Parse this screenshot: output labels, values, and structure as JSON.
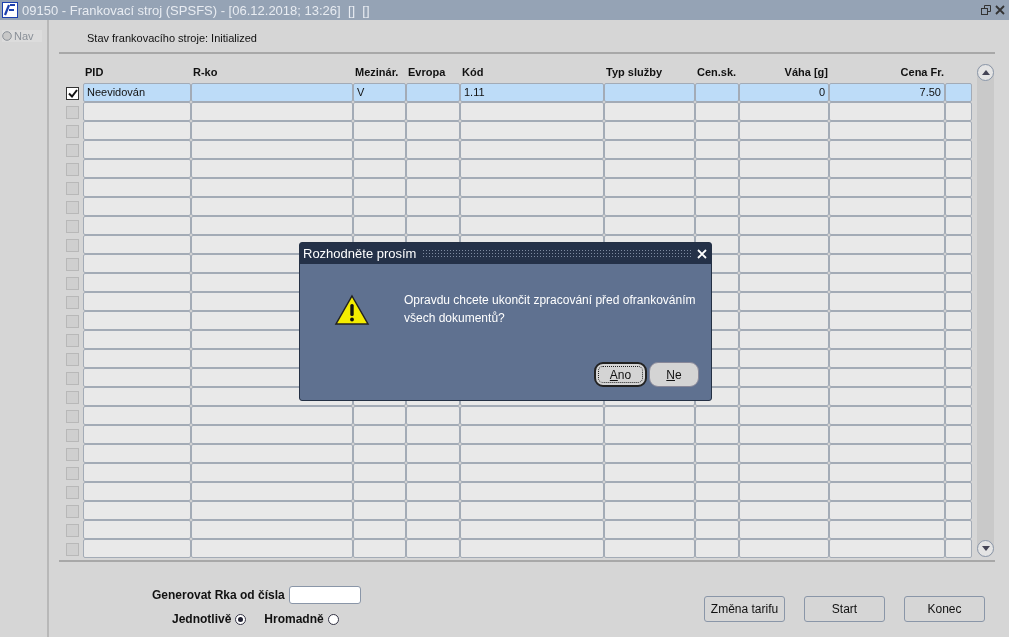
{
  "window": {
    "title": "09150 - Frankovací stroj (SPSFS) - [06.12.2018; 13:26]  []  []"
  },
  "sidebar": {
    "nav": {
      "label": "Nav",
      "selected": false
    }
  },
  "status": "Stav frankovacího stroje: Initialized",
  "table": {
    "columns": [
      {
        "label": "PID",
        "kind": "text"
      },
      {
        "label": "R-ko",
        "kind": "text"
      },
      {
        "label": "Mezinár.",
        "kind": "text"
      },
      {
        "label": "Evropa",
        "kind": "text"
      },
      {
        "label": "Kód",
        "kind": "text"
      },
      {
        "label": "Typ služby",
        "kind": "text"
      },
      {
        "label": "Cen.sk.",
        "kind": "text"
      },
      {
        "label": "Váha [g]",
        "kind": "number"
      },
      {
        "label": "Cena Fr.",
        "kind": "number"
      }
    ],
    "rows": [
      {
        "checked": true,
        "selected": true,
        "cells": {
          "0": "Neevidován",
          "2": "V",
          "4": "1.11",
          "7": "0",
          "8": "7.50"
        }
      },
      {
        "checked": false,
        "selected": false
      },
      {
        "checked": false,
        "selected": false
      },
      {
        "checked": false,
        "selected": false
      },
      {
        "checked": false,
        "selected": false
      },
      {
        "checked": false,
        "selected": false
      },
      {
        "checked": false,
        "selected": false
      },
      {
        "checked": false,
        "selected": false
      },
      {
        "checked": false,
        "selected": false
      },
      {
        "checked": false,
        "selected": false
      },
      {
        "checked": false,
        "selected": false
      },
      {
        "checked": false,
        "selected": false
      },
      {
        "checked": false,
        "selected": false
      },
      {
        "checked": false,
        "selected": false
      },
      {
        "checked": false,
        "selected": false
      },
      {
        "checked": false,
        "selected": false
      },
      {
        "checked": false,
        "selected": false
      },
      {
        "checked": false,
        "selected": false
      },
      {
        "checked": false,
        "selected": false
      },
      {
        "checked": false,
        "selected": false
      },
      {
        "checked": false,
        "selected": false
      },
      {
        "checked": false,
        "selected": false
      },
      {
        "checked": false,
        "selected": false
      },
      {
        "checked": false,
        "selected": false
      },
      {
        "checked": false,
        "selected": false
      }
    ]
  },
  "generate": {
    "label": "Generovat Rka od čísla"
  },
  "mode": [
    {
      "label": "Jednotlivě",
      "selected": true
    },
    {
      "label": "Hromadně",
      "selected": false
    }
  ],
  "buttons": [
    "Změna tarifu",
    "Start",
    "Konec"
  ],
  "dialog": {
    "title": "Rozhodněte prosím",
    "message": "Opravdu chcete ukončit zpracování před ofrankováním všech dokumentů?",
    "buttons": [
      {
        "mnemonic": "A",
        "rest": "no",
        "default": true
      },
      {
        "mnemonic": "N",
        "rest": "e",
        "default": false
      }
    ]
  }
}
